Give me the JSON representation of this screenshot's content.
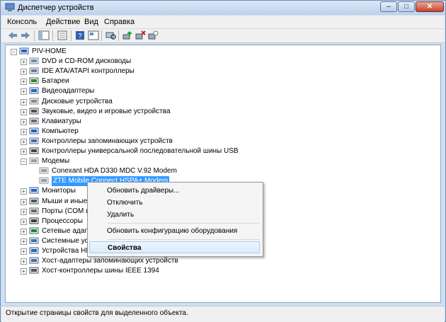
{
  "window": {
    "title": "Диспетчер устройств",
    "buttons": {
      "minimize": "–",
      "maximize": "□",
      "close": "✕"
    }
  },
  "menu": [
    "Консоль",
    "Действие",
    "Вид",
    "Справка"
  ],
  "toolbar": [
    "back-icon",
    "forward-icon",
    "console-tree-icon",
    "properties-icon",
    "help-icon",
    "view-icon",
    "scan-hardware-icon",
    "update-driver-icon",
    "disable-icon",
    "uninstall-icon"
  ],
  "tree": {
    "root": "PIV-HOME",
    "categories": [
      "DVD и CD-ROM дисководы",
      "IDE ATA/ATAPI контроллеры",
      "Батареи",
      "Видеоадаптеры",
      "Дисковые устройства",
      "Звуковые, видео и игровые устройства",
      "Клавиатуры",
      "Компьютер",
      "Контроллеры запоминающих устройств",
      "Контроллеры универсальной последовательной шины USB",
      "Модемы"
    ],
    "modems": [
      "Conexant HDA D330 MDC V.92 Modem",
      "ZTE Mobile Connect HSPA+ Modem"
    ],
    "categories_after": [
      "Мониторы",
      "Мыши и иные",
      "Порты (COM и",
      "Процессоры",
      "Сетевые адапт",
      "Системные уст",
      "Устройства HID",
      "Хост-адаптеры запоминающих устройств",
      "Хост-контроллеры шины IEEE 1394"
    ]
  },
  "context_menu": {
    "update": "Обновить драйверы...",
    "disable": "Отключить",
    "uninstall": "Удалить",
    "scan": "Обновить конфигурацию оборудования",
    "properties": "Свойства"
  },
  "status": "Открытие страницы свойств для выделенного объекта."
}
